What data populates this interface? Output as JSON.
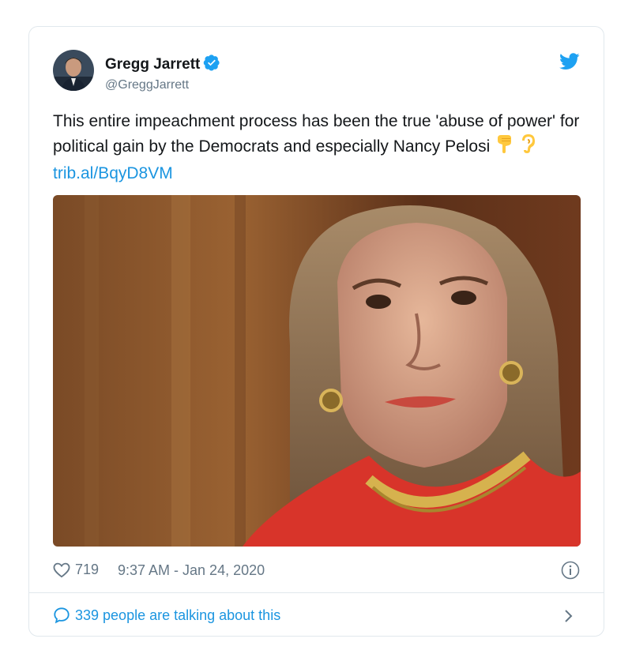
{
  "tweet": {
    "author": {
      "display_name": "Gregg Jarrett",
      "handle": "@GreggJarrett",
      "verified": true
    },
    "text_part1": "This entire impeachment process has been the true 'abuse of power' for political gain by the Democrats and especially Nancy Pelosi",
    "emojis": [
      "backhand-index-pointing-down-emoji",
      "ear-emoji"
    ],
    "link": "trib.al/BqyD8VM",
    "likes": "719",
    "timestamp": "9:37 AM - Jan 24, 2020",
    "conversation_label": "339 people are talking about this"
  },
  "icons": {
    "bird": "twitter-bird-icon",
    "verified": "verified-badge-icon",
    "heart": "heart-icon",
    "info": "info-icon",
    "chat": "speech-bubble-icon",
    "chevron": "chevron-right-icon"
  },
  "colors": {
    "brand_blue": "#1da1f2",
    "link_blue": "#1b95e0",
    "text": "#14171a",
    "muted": "#657786",
    "border": "#e1e8ed"
  }
}
